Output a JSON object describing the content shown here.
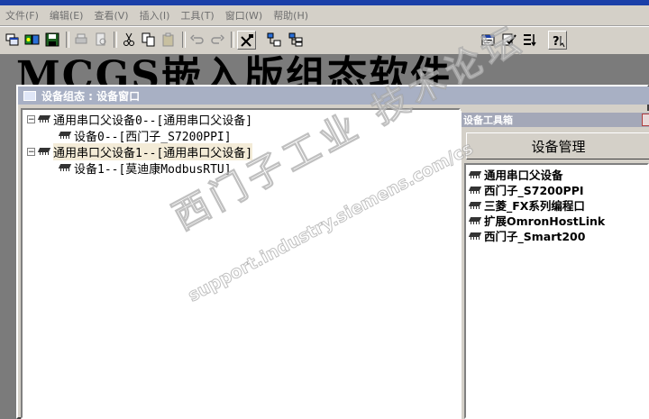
{
  "menubar": {
    "items": [
      "文件(F)",
      "编辑(E)",
      "查看(V)",
      "插入(I)",
      "工具(T)",
      "窗口(W)",
      "帮助(H)"
    ]
  },
  "toolbar": {
    "icons": [
      "window-icon",
      "device-chip-icon",
      "save-icon",
      "print-icon",
      "print-preview-icon",
      "cut-icon",
      "copy-icon",
      "paste-icon",
      "undo-icon",
      "redo-icon",
      "tools-icon",
      "tree-icon",
      "tree-grid-icon",
      "properties-icon",
      "check-icon",
      "sort-icon",
      "help-icon"
    ]
  },
  "background": {
    "banner": "MCGS嵌入版组态软件"
  },
  "device_window": {
    "title": "设备组态 : 设备窗口",
    "tree": [
      {
        "expander": "−",
        "label": "通用串口父设备0--[通用串口父设备]",
        "level": 0,
        "selected": false
      },
      {
        "label": "设备0--[西门子_S7200PPI]",
        "level": 1,
        "selected": false
      },
      {
        "expander": "−",
        "label": "通用串口父设备1--[通用串口父设备]",
        "level": 0,
        "selected": true
      },
      {
        "label": "设备1--[莫迪康ModbusRTU]",
        "level": 1,
        "selected": false
      }
    ]
  },
  "toolbox": {
    "title": "设备工具箱",
    "manage_button": "设备管理",
    "items": [
      "通用串口父设备",
      "西门子_S7200PPI",
      "三菱_FX系列编程口",
      "扩展OmronHostLink",
      "西门子_Smart200"
    ]
  },
  "watermark": {
    "line1": "西门子工业 技术论坛",
    "line2": "support.industry.siemens.com/cs"
  }
}
